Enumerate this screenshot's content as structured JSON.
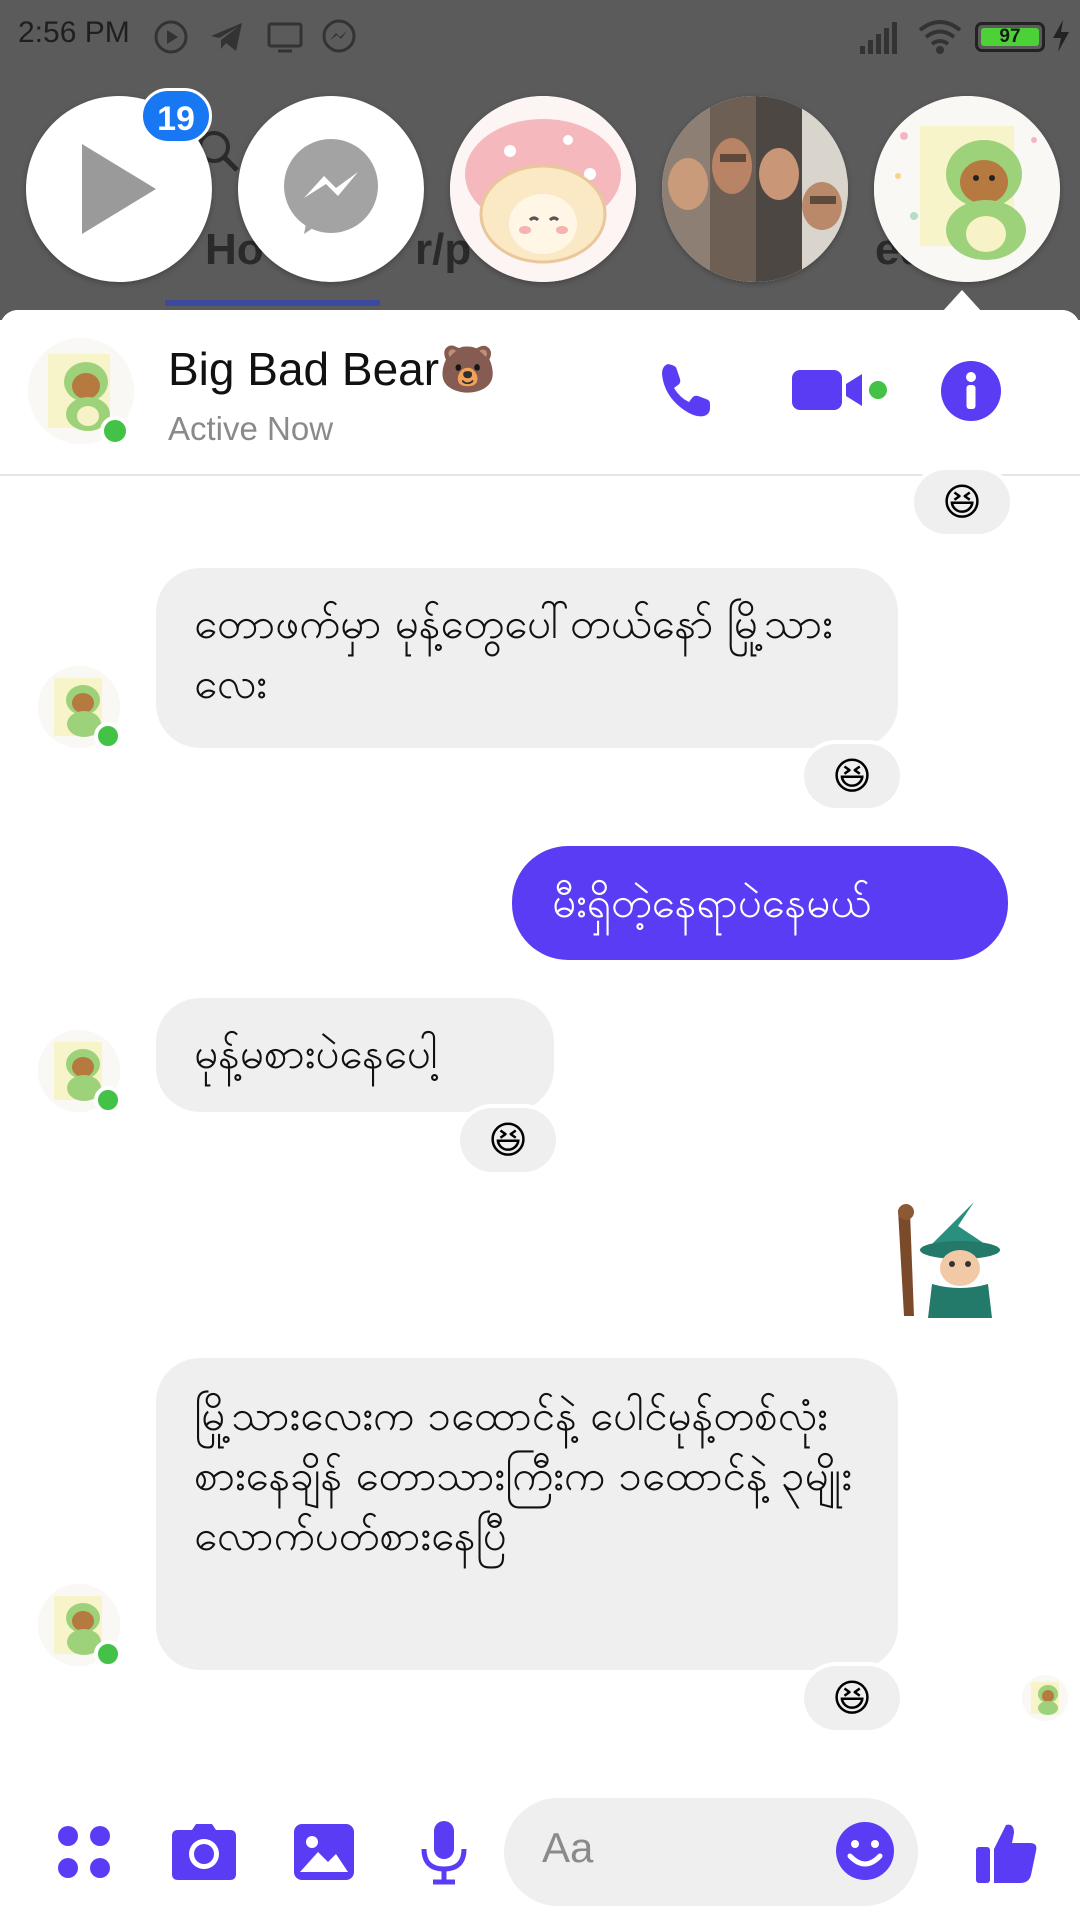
{
  "status_bar": {
    "time": "2:56 PM",
    "battery": "97"
  },
  "chat_heads": {
    "unread_badge": "19"
  },
  "background_app": {
    "tab_left": "Ho",
    "tab_mid": "r/p",
    "tab_right": "ed"
  },
  "conversation": {
    "name": "Big Bad Bear🐻",
    "status": "Active Now",
    "colors": {
      "accent": "#5b3cf5",
      "online": "#44c247",
      "incoming_bubble": "#efefef"
    }
  },
  "messages": [
    {
      "reaction": "😆"
    },
    {
      "text": "တောဖက်မှာ မုန့်တွေပေါ်တယ်နော် မြို့သားလေး",
      "reaction": "😆"
    },
    {
      "text": "မီးရှိတဲ့နေရာပဲနေမယ်"
    },
    {
      "text": "မုန့်မစားပဲနေပေါ့",
      "reaction": "😆"
    },
    {
      "sticker": "wizard-sticker"
    },
    {
      "text": "မြို့သားလေးက ၁ထောင်နဲ့ ပေါင်မုန့်တစ်လုံးစားနေချိန် တောသားကြီးက ၁ထောင်နဲ့ ၃မျိုး လောက်ပတ်စားနေပြီ",
      "reaction": "😆"
    }
  ],
  "composer": {
    "placeholder": "Aa"
  }
}
